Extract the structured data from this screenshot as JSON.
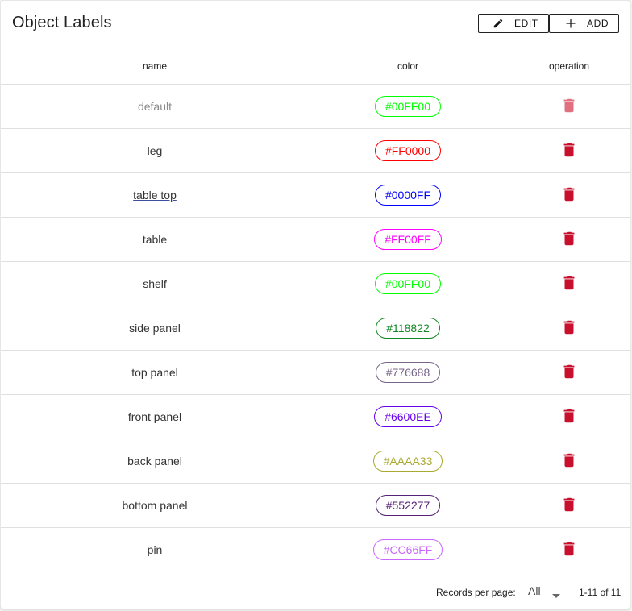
{
  "header": {
    "title": "Object Labels",
    "edit_label": "EDIT",
    "add_label": "ADD"
  },
  "columns": {
    "name": "name",
    "color": "color",
    "operation": "operation"
  },
  "rows": [
    {
      "name": "default",
      "color": "#00FF00",
      "color_hex": "#00FF00",
      "muted": true,
      "link": false
    },
    {
      "name": "leg",
      "color": "#FF0000",
      "color_hex": "#FF0000",
      "muted": false,
      "link": false
    },
    {
      "name": "table top",
      "color": "#0000FF",
      "color_hex": "#0000FF",
      "muted": false,
      "link": true
    },
    {
      "name": "table",
      "color": "#FF00FF",
      "color_hex": "#FF00FF",
      "muted": false,
      "link": false
    },
    {
      "name": "shelf",
      "color": "#00FF00",
      "color_hex": "#00FF00",
      "muted": false,
      "link": false
    },
    {
      "name": "side panel",
      "color": "#118822",
      "color_hex": "#118822",
      "muted": false,
      "link": false
    },
    {
      "name": "top panel",
      "color": "#776688",
      "color_hex": "#776688",
      "muted": false,
      "link": false
    },
    {
      "name": "front panel",
      "color": "#6600EE",
      "color_hex": "#6600EE",
      "muted": false,
      "link": false
    },
    {
      "name": "back panel",
      "color": "#AAAA33",
      "color_hex": "#AAAA33",
      "muted": false,
      "link": false
    },
    {
      "name": "bottom panel",
      "color": "#552277",
      "color_hex": "#552277",
      "muted": false,
      "link": false
    },
    {
      "name": "pin",
      "color": "#CC66FF",
      "color_hex": "#CC66FF",
      "muted": false,
      "link": false
    }
  ],
  "icons": {
    "edit": "pencil-icon",
    "add": "plus-icon",
    "delete": "trash-icon",
    "dropdown": "caret-down-icon"
  },
  "colors": {
    "delete_icon": "#C8102E",
    "delete_icon_disabled": "#E07080"
  },
  "footer": {
    "records_per_page_label": "Records per page:",
    "records_per_page_value": "All",
    "range_text": "1-11 of 11"
  }
}
